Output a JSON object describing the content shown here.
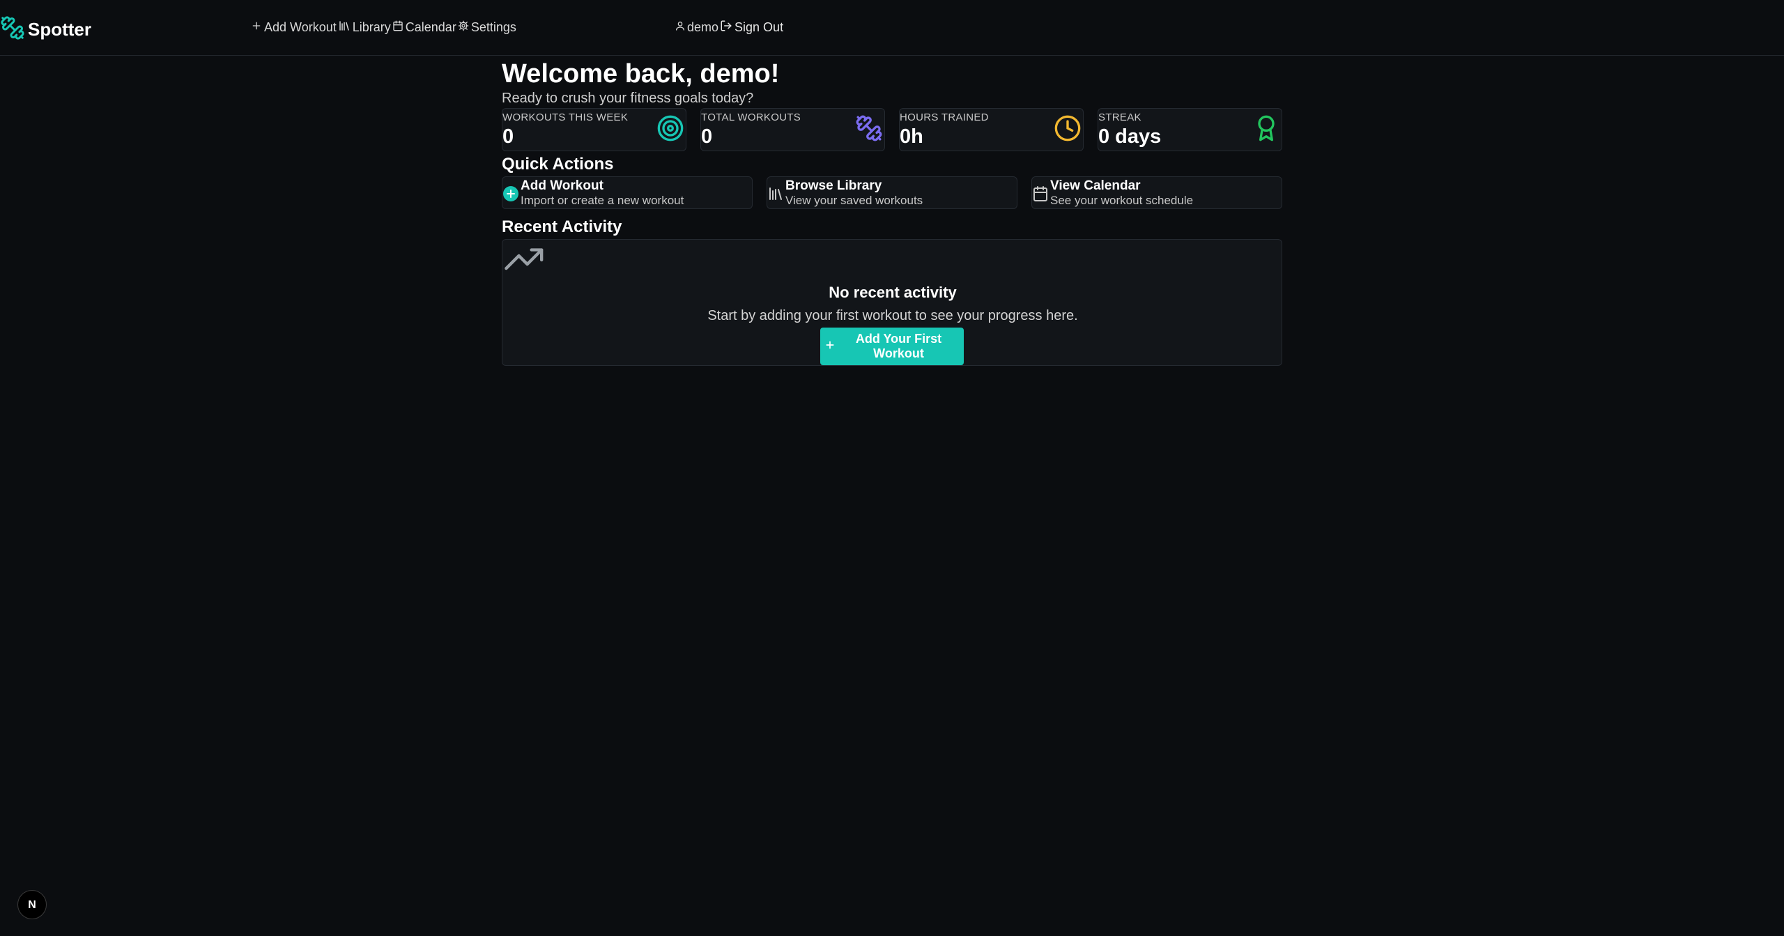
{
  "brand": {
    "name": "Spotter",
    "icon": "dumbbell-icon",
    "accent": "#17c6b4"
  },
  "nav": {
    "items": [
      {
        "label": "Add Workout",
        "icon": "plus-icon"
      },
      {
        "label": "Library",
        "icon": "library-icon"
      },
      {
        "label": "Calendar",
        "icon": "calendar-icon"
      },
      {
        "label": "Settings",
        "icon": "gear-icon"
      }
    ]
  },
  "user": {
    "name": "demo",
    "icon": "user-icon",
    "signout_label": "Sign Out",
    "signout_icon": "logout-icon"
  },
  "dashboard": {
    "welcome": "Welcome back, demo!",
    "subtitle": "Ready to crush your fitness goals today?",
    "stats": [
      {
        "label": "WORKOUTS THIS WEEK",
        "value": "0",
        "icon": "target-icon",
        "color": "#17c6b4"
      },
      {
        "label": "TOTAL WORKOUTS",
        "value": "0",
        "icon": "dumbbell-icon",
        "color": "#7b6cf0"
      },
      {
        "label": "HOURS TRAINED",
        "value": "0h",
        "icon": "clock-icon",
        "color": "#f2b830"
      },
      {
        "label": "STREAK",
        "value": "0 days",
        "icon": "award-icon",
        "color": "#22c55e"
      }
    ],
    "quick_actions_title": "Quick Actions",
    "quick_actions": [
      {
        "title": "Add Workout",
        "desc": "Import or create a new workout",
        "icon": "plus-circle-icon"
      },
      {
        "title": "Browse Library",
        "desc": "View your saved workouts",
        "icon": "library-icon"
      },
      {
        "title": "View Calendar",
        "desc": "See your workout schedule",
        "icon": "calendar-icon"
      }
    ],
    "recent_activity_title": "Recent Activity",
    "empty_state": {
      "icon": "trending-up-icon",
      "title": "No recent activity",
      "desc": "Start by adding your first workout to see your progress here.",
      "button_label": "Add Your First Workout"
    }
  },
  "dev_badge": {
    "label": "N"
  }
}
